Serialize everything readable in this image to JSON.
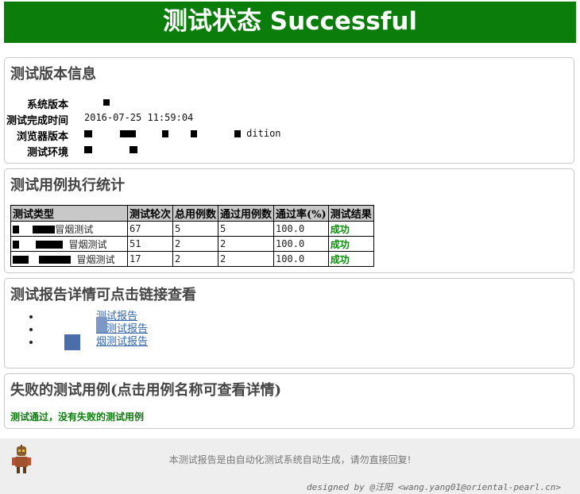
{
  "banner": {
    "title": "测试状态 Successful"
  },
  "version_info": {
    "title": "测试版本信息",
    "rows": [
      {
        "label": "系统版本",
        "value": ""
      },
      {
        "label": "测试完成时间",
        "value": "2016-07-25 11:59:04"
      },
      {
        "label": "浏览器版本",
        "value": "dition"
      },
      {
        "label": "测试环境",
        "value": ""
      }
    ]
  },
  "stats": {
    "title": "测试用例执行统计",
    "headers": [
      "测试类型",
      "测试轮次",
      "总用例数",
      "通过用例数",
      "通过率(%)",
      "测试结果"
    ],
    "rows": [
      {
        "type": "冒烟测试",
        "rounds": "67",
        "total": "5",
        "passed": "5",
        "rate": "100.0",
        "result": "成功"
      },
      {
        "type": "冒烟测试",
        "rounds": "51",
        "total": "2",
        "passed": "2",
        "rate": "100.0",
        "result": "成功"
      },
      {
        "type": "冒烟测试",
        "rounds": "17",
        "total": "2",
        "passed": "2",
        "rate": "100.0",
        "result": "成功"
      }
    ]
  },
  "reports": {
    "title": "测试报告详情可点击链接查看",
    "links": [
      "测试报告",
      "烟测试报告",
      "烟测试报告"
    ]
  },
  "failures": {
    "title": "失败的测试用例(点击用例名称可查看详情)",
    "message": "测试通过，没有失败的测试用例"
  },
  "footer": {
    "text": "本测试报告是由自动化测试系统自动生成，请勿直接回复!",
    "credit": "designed by @汪阳 <wang.yang01@oriental-pearl.cn>"
  },
  "colors": {
    "banner": "#0a7d0a",
    "success": "#0a8a0a",
    "link": "#3366aa"
  }
}
